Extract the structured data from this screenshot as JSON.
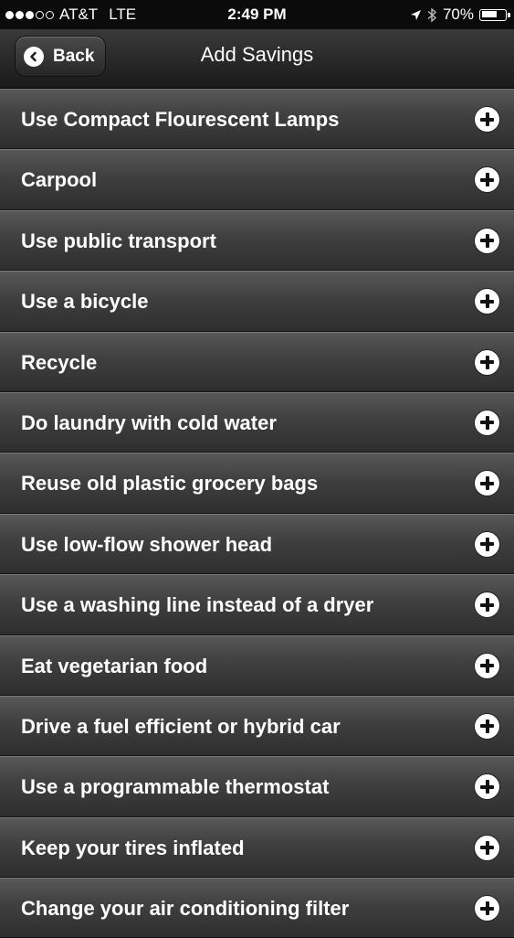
{
  "status_bar": {
    "carrier": "AT&T",
    "network": "LTE",
    "time": "2:49 PM",
    "battery_percent_text": "70%",
    "battery_level": 0.7,
    "signal_bars_filled": 3,
    "signal_bars_total": 5
  },
  "nav": {
    "back_label": "Back",
    "title": "Add Savings"
  },
  "items": [
    {
      "label": "Use Compact Flourescent Lamps"
    },
    {
      "label": "Carpool"
    },
    {
      "label": "Use public transport"
    },
    {
      "label": "Use a bicycle"
    },
    {
      "label": "Recycle"
    },
    {
      "label": "Do laundry with cold water"
    },
    {
      "label": "Reuse old plastic grocery bags"
    },
    {
      "label": "Use low-flow shower head"
    },
    {
      "label": "Use a washing line instead of a dryer"
    },
    {
      "label": "Eat vegetarian food"
    },
    {
      "label": "Drive a fuel efficient or hybrid car"
    },
    {
      "label": "Use a programmable thermostat"
    },
    {
      "label": "Keep your tires inflated"
    },
    {
      "label": "Change your air conditioning filter"
    }
  ],
  "icons": {
    "row_action": "plus-icon",
    "back": "chevron-left-icon"
  }
}
